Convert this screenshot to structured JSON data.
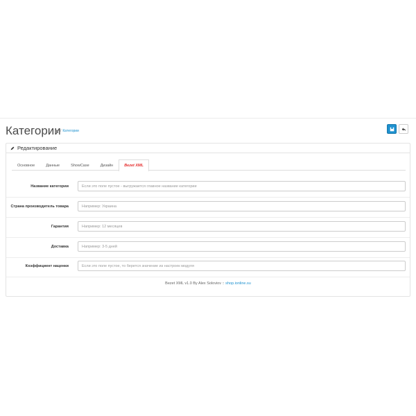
{
  "header": {
    "title": "Категории",
    "breadcrumb": {
      "separator": "/",
      "current": "Категории"
    },
    "colors": {
      "accent": "#1e91cf"
    },
    "buttons": {
      "save_icon": "save-icon",
      "back_icon": "reply-icon"
    }
  },
  "panel": {
    "title": "Редактирование",
    "title_icon": "pencil-icon"
  },
  "tabs": [
    {
      "label": "Основное"
    },
    {
      "label": "Данные"
    },
    {
      "label": "ShowCase"
    },
    {
      "label": "Дизайн"
    },
    {
      "label": "Bezet XML",
      "active": true
    }
  ],
  "form": {
    "fields": [
      {
        "label": "Название категории",
        "value": "",
        "placeholder": "Если это поле пустое - выгружается главное название категории"
      },
      {
        "label": "Страна производитель товара",
        "value": "",
        "placeholder": "Например: Украина"
      },
      {
        "label": "Гарантия",
        "value": "",
        "placeholder": "Например: 12 месяцев"
      },
      {
        "label": "Доставка",
        "value": "",
        "placeholder": "Например: 3-5 дней"
      },
      {
        "label": "Коэффициент наценки",
        "value": "",
        "placeholder": "Если это поле пустое, то берется значение из настроек модуля"
      }
    ]
  },
  "footer": {
    "text": "Bezet XML v1.0 By Alex Soloviov ::",
    "link": "shop.ionline.su"
  }
}
